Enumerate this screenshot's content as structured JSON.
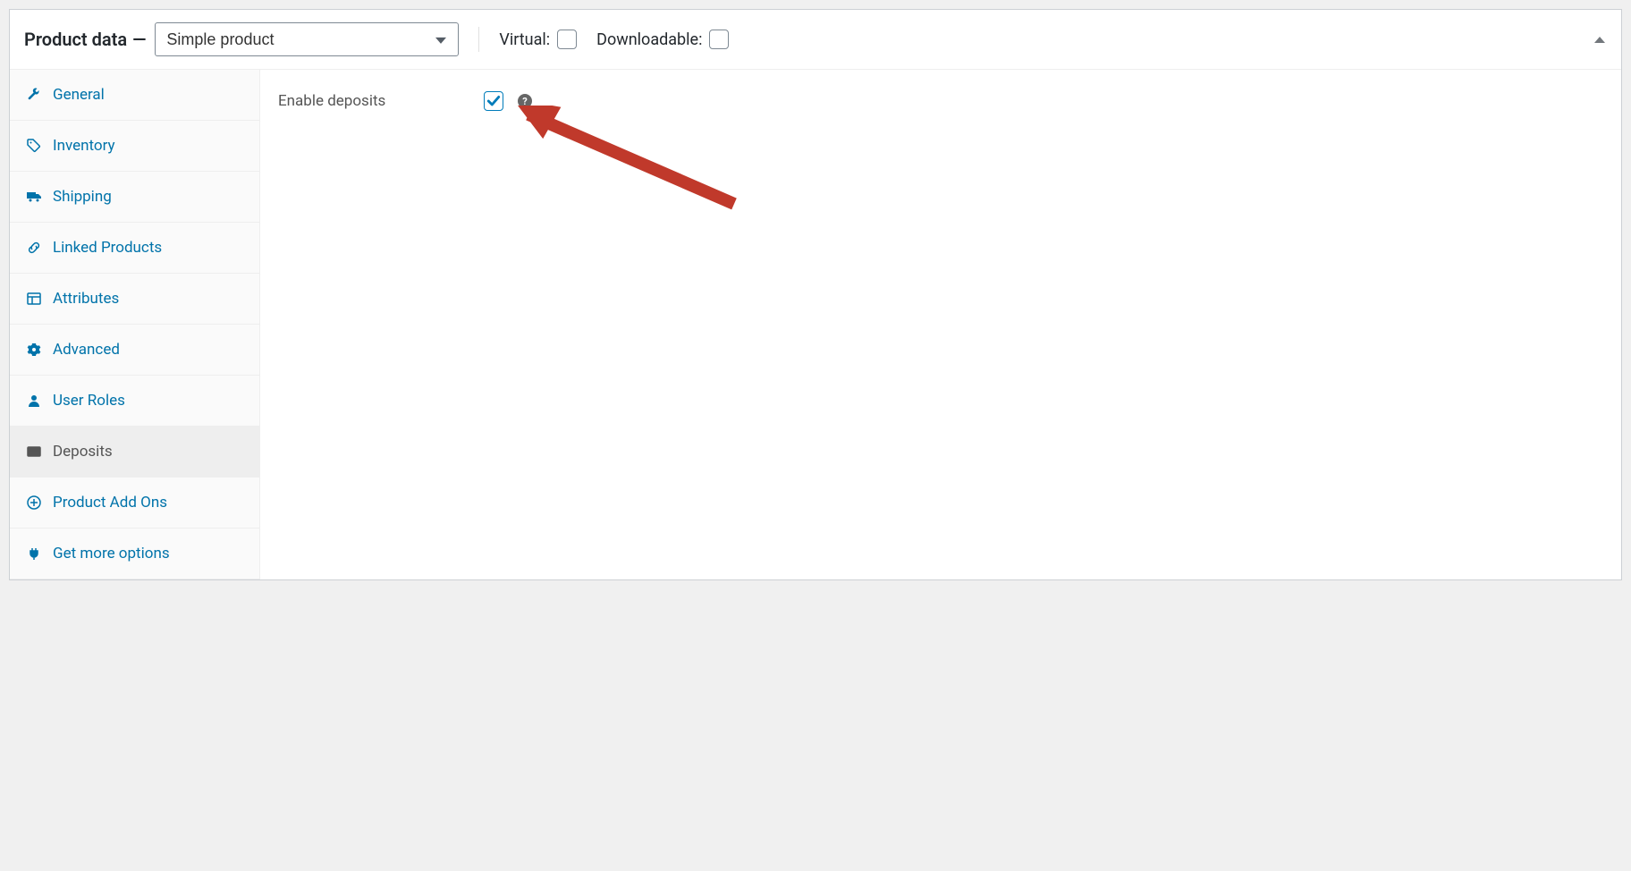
{
  "header": {
    "title": "Product data",
    "dash": "—",
    "product_type_selected": "Simple product",
    "virtual_label": "Virtual:",
    "downloadable_label": "Downloadable:"
  },
  "tabs": [
    {
      "id": "general",
      "label": "General",
      "icon": "wrench-icon"
    },
    {
      "id": "inventory",
      "label": "Inventory",
      "icon": "tag-icon"
    },
    {
      "id": "shipping",
      "label": "Shipping",
      "icon": "truck-icon"
    },
    {
      "id": "linked",
      "label": "Linked Products",
      "icon": "link-icon"
    },
    {
      "id": "attributes",
      "label": "Attributes",
      "icon": "layout-icon"
    },
    {
      "id": "advanced",
      "label": "Advanced",
      "icon": "gear-icon"
    },
    {
      "id": "userroles",
      "label": "User Roles",
      "icon": "user-icon"
    },
    {
      "id": "deposits",
      "label": "Deposits",
      "icon": "card-icon",
      "active": true
    },
    {
      "id": "addons",
      "label": "Product Add Ons",
      "icon": "plus-circle-icon"
    },
    {
      "id": "more",
      "label": "Get more options",
      "icon": "plug-icon"
    }
  ],
  "panel": {
    "enable_deposits_label": "Enable deposits",
    "enable_deposits_checked": true,
    "help_tip": "?"
  }
}
